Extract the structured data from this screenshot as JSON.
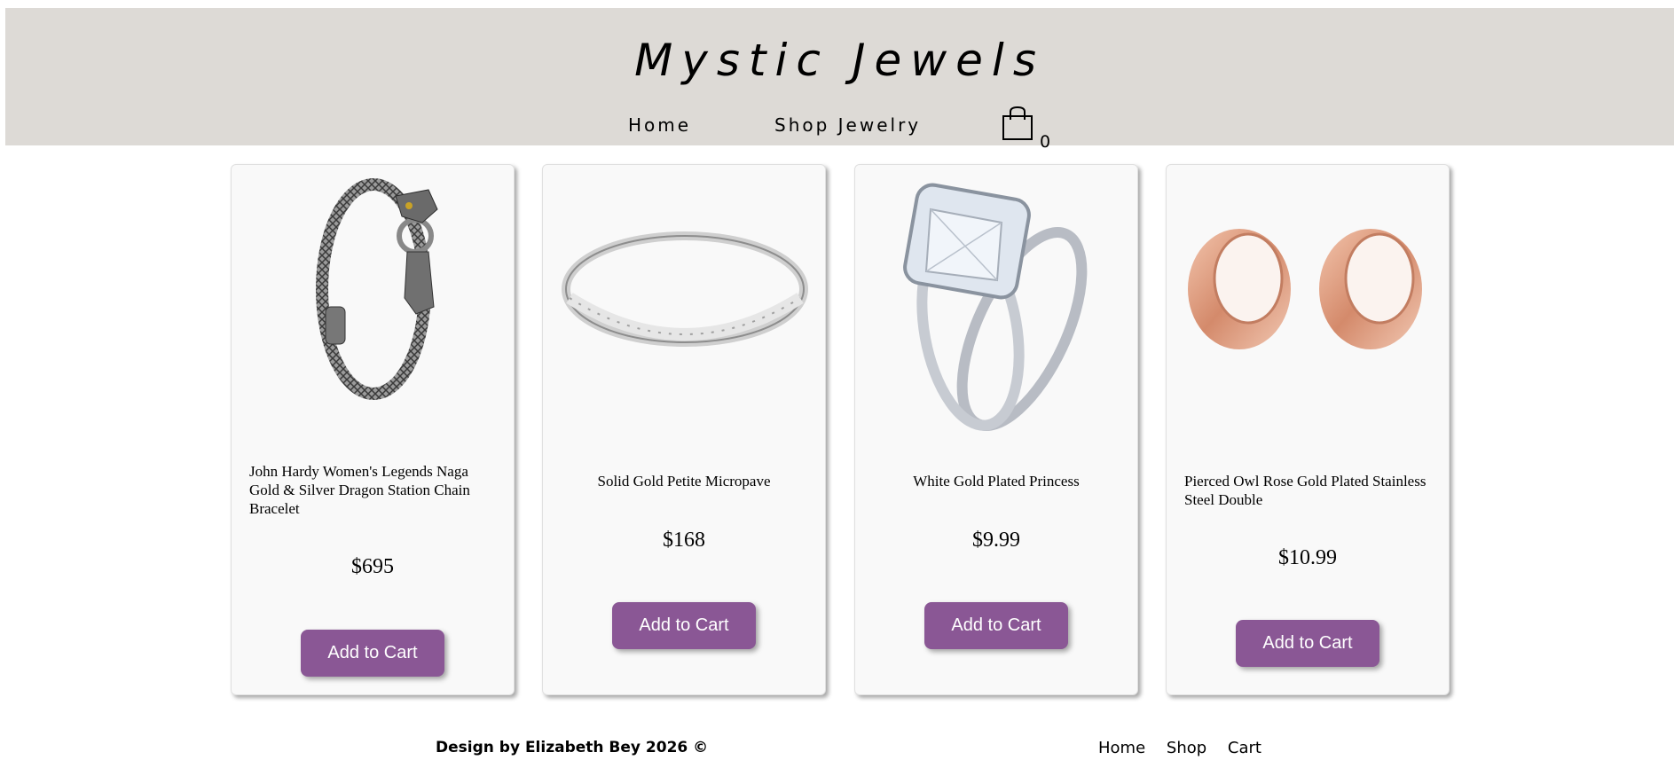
{
  "header": {
    "brand": "Mystic Jewels",
    "nav": {
      "home": "Home",
      "shop": "Shop Jewelry"
    },
    "cart_count": "0",
    "background": "#dddad6"
  },
  "products": [
    {
      "title": "John Hardy Women's Legends Naga Gold & Silver Dragon Station Chain Bracelet",
      "price": "$695",
      "button": "Add to Cart",
      "image": "silver-dragon-bracelet"
    },
    {
      "title": "Solid Gold Petite Micropave",
      "price": "$168",
      "button": "Add to Cart",
      "image": "diamond-band-ring"
    },
    {
      "title": "White Gold Plated Princess",
      "price": "$9.99",
      "button": "Add to Cart",
      "image": "princess-cut-ring-set"
    },
    {
      "title": "Pierced Owl Rose Gold Plated Stainless Steel Double",
      "price": "$10.99",
      "button": "Add to Cart",
      "image": "rose-gold-plugs"
    }
  ],
  "accent_color": "#8a5795",
  "footer": {
    "credit": "Design by Elizabeth Bey 2026 ©",
    "links": [
      "Home",
      "Shop",
      "Cart"
    ]
  }
}
